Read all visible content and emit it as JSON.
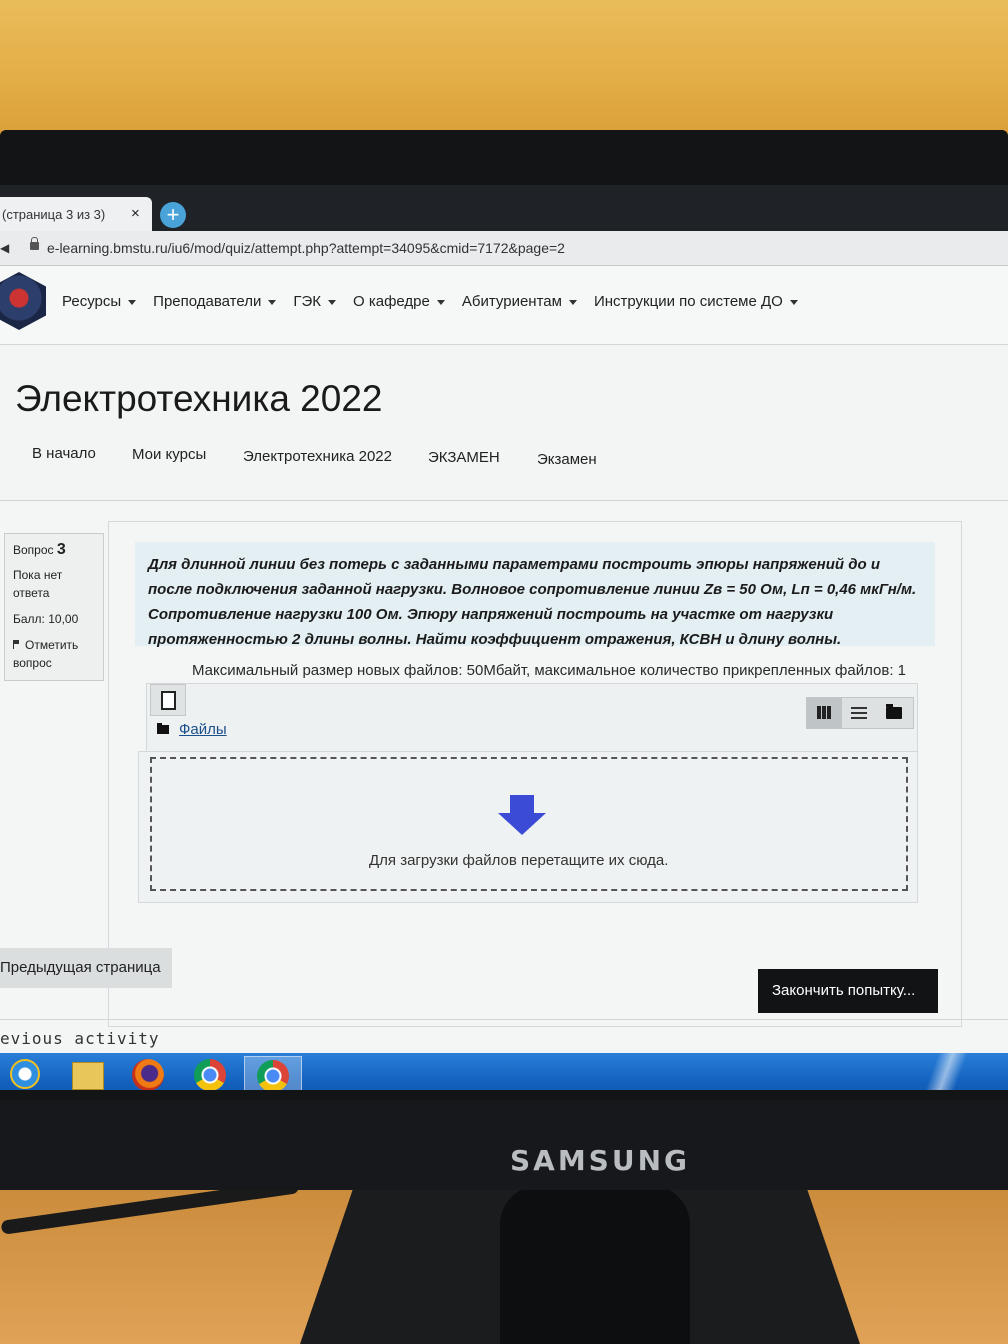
{
  "browser": {
    "tab_title": "(страница 3 из 3)",
    "tab_close": "×",
    "new_tab": "+",
    "url": "e-learning.bmstu.ru/iu6/mod/quiz/attempt.php?attempt=34095&cmid=7172&page=2"
  },
  "topnav": {
    "items": [
      "Ресурсы",
      "Преподаватели",
      "ГЭК",
      "О кафедре",
      "Абитуриентам",
      "Инструкции по системе ДО"
    ]
  },
  "header": {
    "course_title": "Электротехника 2022",
    "breadcrumbs": [
      "В начало",
      "Мои курсы",
      "Электротехника 2022",
      "ЭКЗАМЕН",
      "Экзамен"
    ]
  },
  "question_info": {
    "label": "Вопрос",
    "number": "3",
    "status_line1": "Пока нет",
    "status_line2": "ответа",
    "score": "Балл: 10,00",
    "flag_line1": "Отметить",
    "flag_line2": "вопрос"
  },
  "question": {
    "text": "Для длинной линии без потерь с заданными параметрами построить эпюры напряжений до и после подключения заданной нагрузки. Волновое сопротивление линии Zв = 50 Ом, Lп = 0,46 мкГн/м. Сопротивление нагрузки 100 Ом. Эпюру напряжений построить на участке от нагрузки протяженностью 2 длины волны.  Найти коэффициент отражения, КСВН и длину волны."
  },
  "filepicker": {
    "limits": "Максимальный размер новых файлов: 50Мбайт, максимальное количество прикрепленных файлов: 1",
    "files_label": "Файлы",
    "drop_text": "Для загрузки файлов перетащите их сюда."
  },
  "navigation": {
    "prev_page": "Предыдущая страница",
    "finish": "Закончить попытку...",
    "previous_activity": "evious activity"
  },
  "monitor": {
    "brand": "SAMSUNG"
  },
  "taskbar": {
    "apps": [
      "internet-explorer",
      "file-explorer",
      "firefox",
      "chrome",
      "chrome"
    ]
  }
}
